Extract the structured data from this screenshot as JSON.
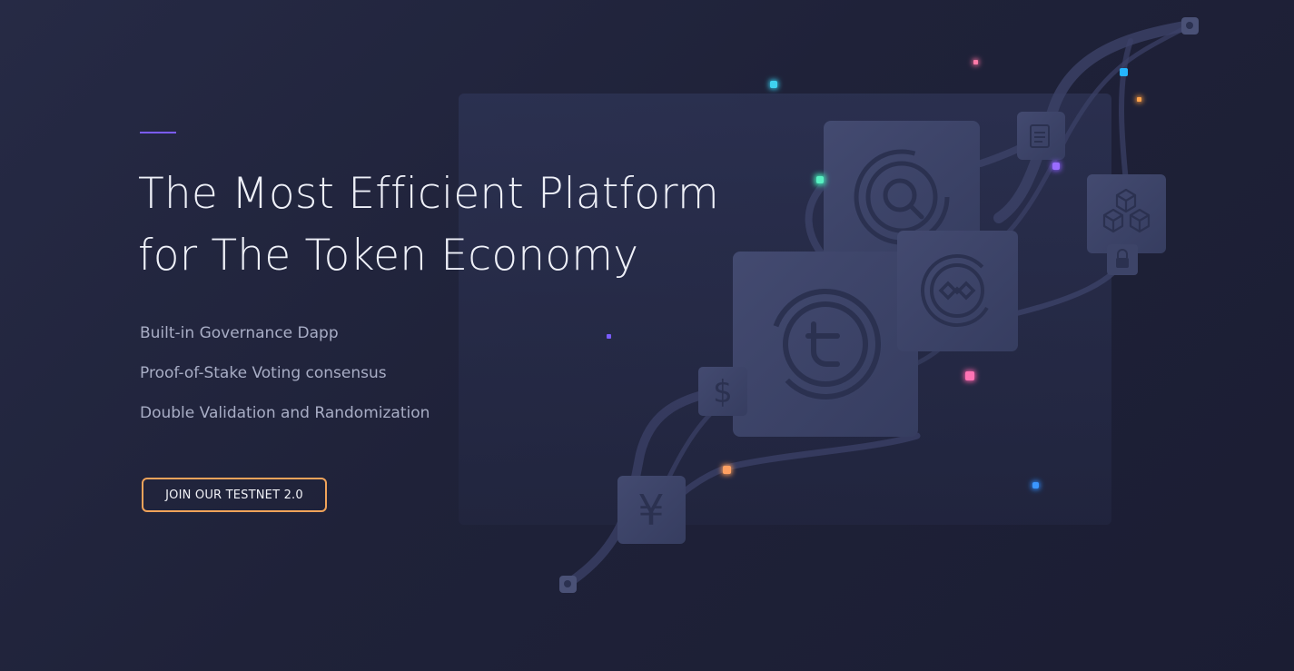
{
  "hero": {
    "title_line_1": "The Most Efficient Platform",
    "title_line_2": "for The Token Economy",
    "features": [
      "Built-in Governance Dapp",
      "Proof-of-Stake Voting consensus",
      "Double Validation and Randomization"
    ],
    "cta_label": "JOIN OUR TESTNET 2.0"
  },
  "illustration": {
    "tiles": [
      {
        "icon": "token-t-logo-icon",
        "glyph": "t"
      },
      {
        "icon": "search-coin-icon"
      },
      {
        "icon": "infinity-coin-icon"
      },
      {
        "icon": "dollar-icon",
        "glyph": "$"
      },
      {
        "icon": "yen-icon",
        "glyph": "¥"
      },
      {
        "icon": "blocks-cubes-icon"
      },
      {
        "icon": "lock-icon"
      },
      {
        "icon": "document-icon"
      }
    ]
  },
  "colors": {
    "background": "#1f2239",
    "accent_line": "#7b5cff",
    "cta_border": "#f0a35a",
    "headline": "#eef0f8",
    "feature_text": "#a8adc5",
    "tile": "#3a4163",
    "tile_icon": "#2b3150"
  }
}
